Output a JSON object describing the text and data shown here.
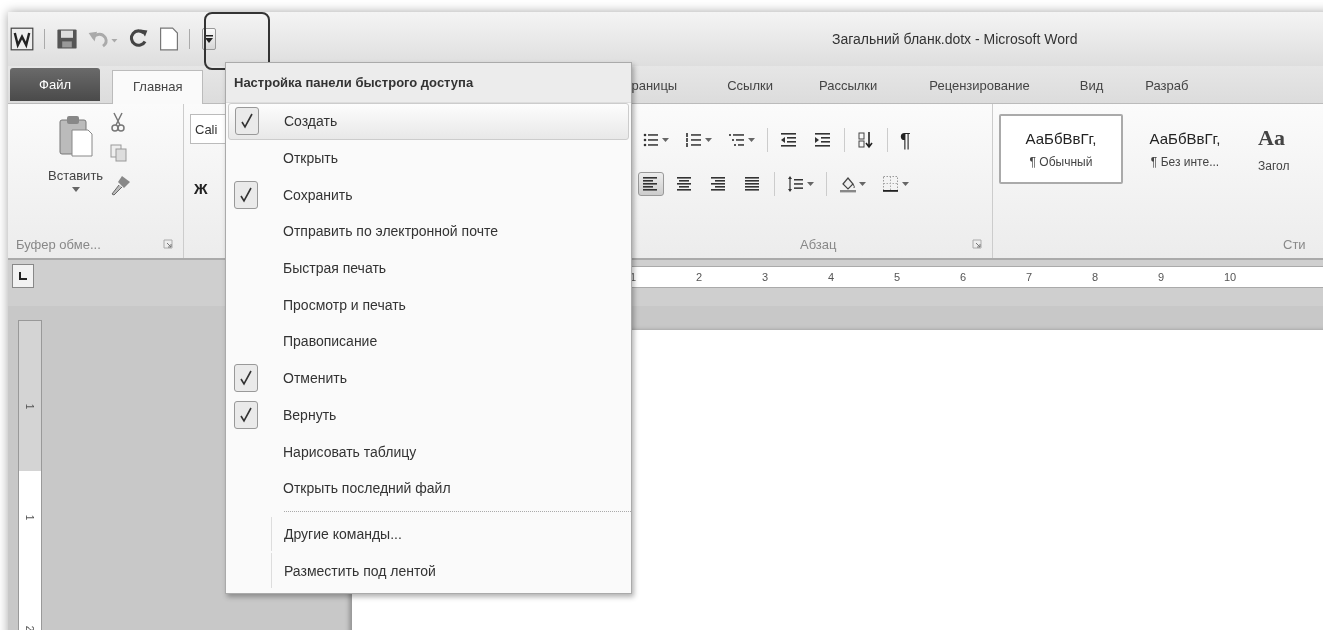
{
  "window": {
    "title": "Загальний бланк.dotx - Microsoft Word"
  },
  "quick_access": {
    "items": [
      {
        "kind": "word"
      },
      {
        "kind": "save"
      },
      {
        "kind": "undo",
        "disabled": true
      },
      {
        "kind": "redo",
        "disabled": false
      },
      {
        "kind": "new",
        "disabled": false
      },
      {
        "kind": "customize",
        "highlighted": true
      }
    ]
  },
  "tabs": [
    {
      "label": "Файл",
      "kind": "file",
      "selected": false
    },
    {
      "label": "Главная",
      "kind": "tab",
      "selected": true
    },
    {
      "label": "раницы",
      "kind": "tab",
      "selected": false
    },
    {
      "label": "Ссылки",
      "kind": "tab",
      "selected": false
    },
    {
      "label": "Рассылки",
      "kind": "tab",
      "selected": false
    },
    {
      "label": "Рецензирование",
      "kind": "tab",
      "selected": false
    },
    {
      "label": "Вид",
      "kind": "tab",
      "selected": false
    },
    {
      "label": "Разраб",
      "kind": "tab",
      "selected": false
    }
  ],
  "clipboard": {
    "paste_label": "Вставить",
    "group_label": "Буфер обме..."
  },
  "font": {
    "name": "Cali",
    "bold_label": "Ж"
  },
  "paragraph": {
    "group_label": "Абзац",
    "row_1": [
      {
        "kind": "bullets",
        "dropdown": true
      },
      {
        "kind": "numbering",
        "dropdown": true
      },
      {
        "kind": "multilevel",
        "dropdown": true
      },
      {
        "kind": "sep"
      },
      {
        "kind": "outdent",
        "dropdown": false
      },
      {
        "kind": "indent",
        "dropdown": false
      },
      {
        "kind": "sep"
      },
      {
        "kind": "sort",
        "dropdown": false
      },
      {
        "kind": "sep"
      },
      {
        "kind": "pilcrow",
        "dropdown": false,
        "label": "¶"
      }
    ],
    "row_2": [
      {
        "kind": "align-left",
        "selected": true
      },
      {
        "kind": "align-center",
        "selected": false
      },
      {
        "kind": "align-right",
        "selected": false
      },
      {
        "kind": "justify",
        "selected": false
      },
      {
        "kind": "sep"
      },
      {
        "kind": "line-spacing",
        "selected": false
      },
      {
        "kind": "sep"
      },
      {
        "kind": "shading",
        "selected": false
      },
      {
        "kind": "borders",
        "selected": false
      }
    ]
  },
  "styles": {
    "group_label": "Сти",
    "items": [
      {
        "sample": "АаБбВвГг,",
        "name": "¶ Обычный",
        "kind": "normal",
        "selected": true
      },
      {
        "sample": "АаБбВвГг,",
        "name": "¶ Без инте...",
        "kind": "normal",
        "selected": false
      },
      {
        "sample": "Aa",
        "name": "Загол",
        "kind": "heading",
        "selected": false
      }
    ]
  },
  "ruler": {
    "numbers": [
      "1",
      "2",
      "3",
      "4",
      "5",
      "6",
      "7",
      "8",
      "9",
      "10"
    ]
  },
  "vertical_ruler": {
    "numbers": [
      "1",
      "1",
      "2"
    ]
  },
  "menu": {
    "title": "Настройка панели быстрого доступа",
    "items": [
      {
        "label": "Создать",
        "kind": "item",
        "checked": true,
        "highlighted": true
      },
      {
        "label": "Открыть",
        "kind": "item",
        "checked": false,
        "highlighted": false
      },
      {
        "label": "Сохранить",
        "kind": "item",
        "checked": true,
        "highlighted": false
      },
      {
        "label": "Отправить по электронной почте",
        "kind": "item",
        "checked": false,
        "highlighted": false
      },
      {
        "label": "Быстрая печать",
        "kind": "item",
        "checked": false,
        "highlighted": false
      },
      {
        "label": "Просмотр и печать",
        "kind": "item",
        "checked": false,
        "highlighted": false
      },
      {
        "label": "Правописание",
        "kind": "item",
        "checked": false,
        "highlighted": false
      },
      {
        "label": "Отменить",
        "kind": "item",
        "checked": true,
        "highlighted": false
      },
      {
        "label": "Вернуть",
        "kind": "item",
        "checked": true,
        "highlighted": false
      },
      {
        "label": "Нарисовать таблицу",
        "kind": "item",
        "checked": false,
        "highlighted": false
      },
      {
        "label": "Открыть последний файл",
        "kind": "item",
        "checked": false,
        "highlighted": false
      },
      {
        "kind": "separator"
      },
      {
        "label": "Другие команды...",
        "kind": "command"
      },
      {
        "label": "Разместить под лентой",
        "kind": "command"
      }
    ]
  }
}
